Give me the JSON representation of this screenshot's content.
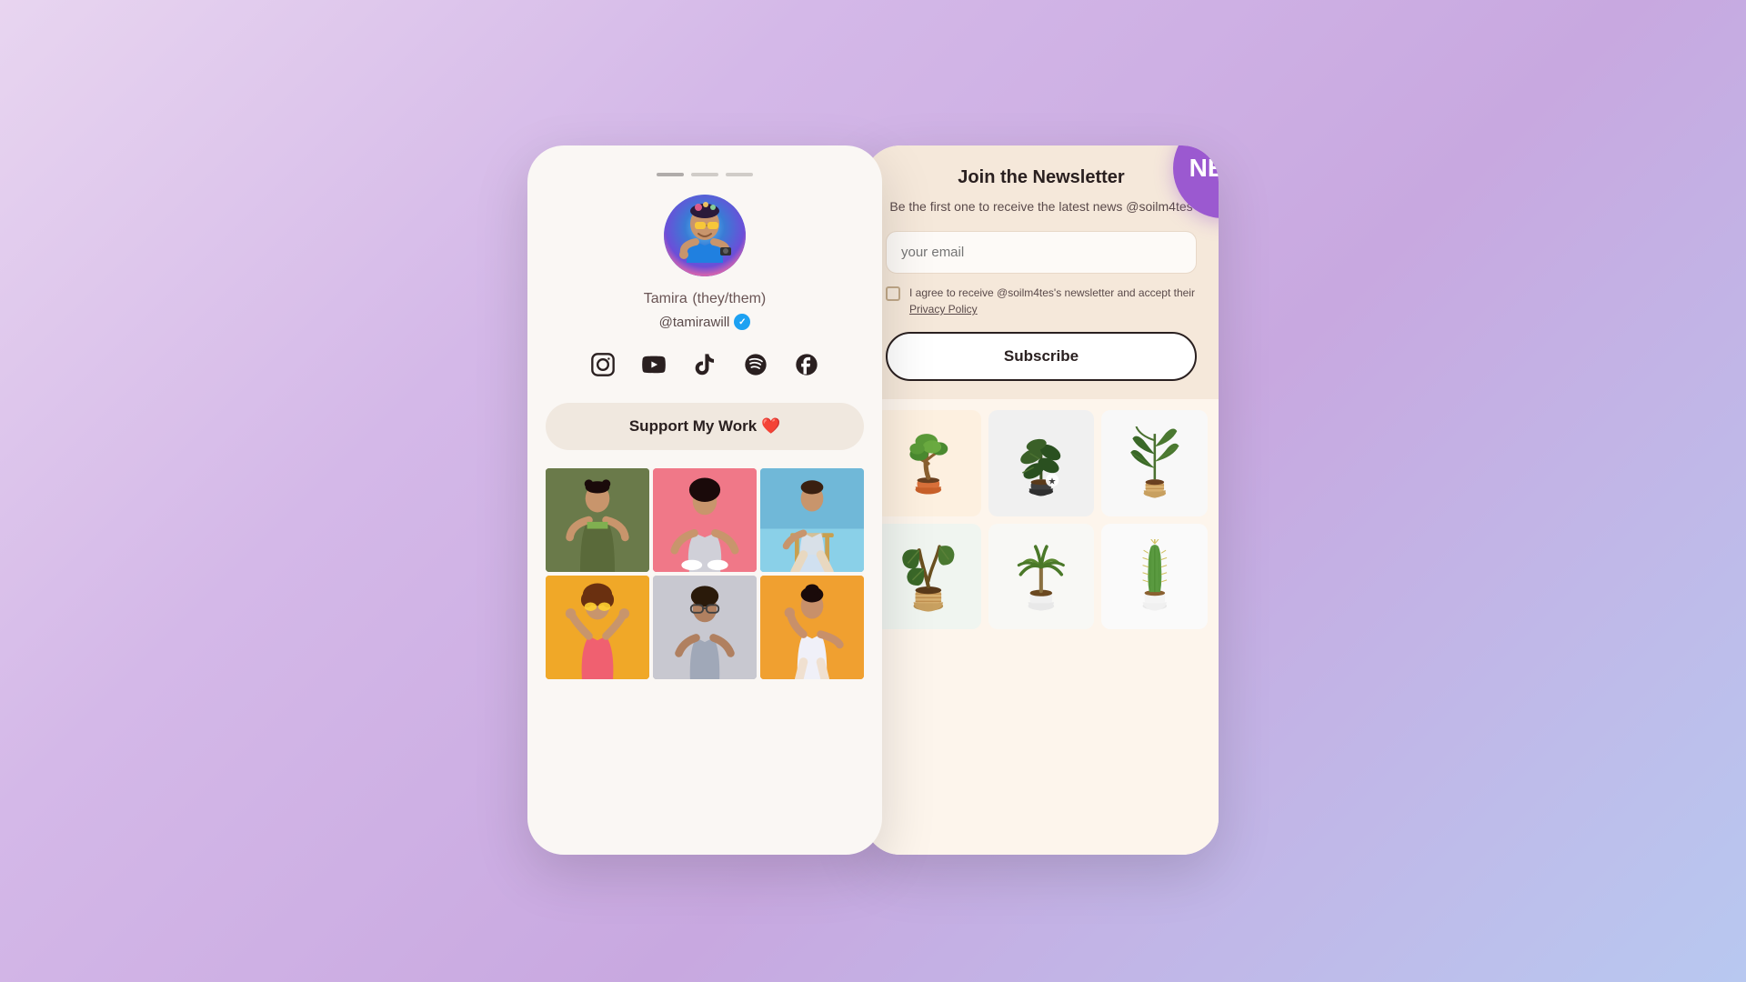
{
  "page": {
    "background": "linear-gradient(135deg, #e8d5f0, #d4b8e8, #c8a8e0, #b8c8f0)"
  },
  "profile_phone": {
    "dots": [
      "dot1",
      "dot2",
      "dot3"
    ],
    "avatar_emoji": "👩🏾",
    "name": "Tamira",
    "pronouns": "(they/them)",
    "handle": "@tamirawill",
    "verified": true,
    "social_links": [
      "instagram",
      "youtube",
      "tiktok",
      "spotify",
      "facebook"
    ],
    "support_button": "Support My Work ❤️",
    "photos": [
      {
        "id": 1,
        "color": "olive-green"
      },
      {
        "id": 2,
        "color": "pink"
      },
      {
        "id": 3,
        "color": "blue"
      },
      {
        "id": 4,
        "color": "orange"
      },
      {
        "id": 5,
        "color": "silver"
      },
      {
        "id": 6,
        "color": "yellow-orange"
      }
    ]
  },
  "newsletter_phone": {
    "new_badge": "NEW!",
    "title": "Join the Newsletter",
    "description": "Be the first one to receive the latest news @soilm4tes",
    "email_placeholder": "your email",
    "checkbox_text": "I agree to receive @soilm4tes's newsletter and accept their ",
    "privacy_policy_link": "Privacy Policy",
    "subscribe_button": "Subscribe",
    "plants": [
      {
        "id": 1,
        "type": "bonsai",
        "bg": "#fdf0e0"
      },
      {
        "id": 2,
        "type": "rubber-plant",
        "bg": "#f0f0f0"
      },
      {
        "id": 3,
        "type": "tall-plant",
        "bg": "#f8f8f8"
      },
      {
        "id": 4,
        "type": "fiddle-leaf",
        "bg": "#f0f5f0"
      },
      {
        "id": 5,
        "type": "dracaena",
        "bg": "#f8f8f5"
      },
      {
        "id": 6,
        "type": "cactus",
        "bg": "#fafafa"
      }
    ]
  }
}
